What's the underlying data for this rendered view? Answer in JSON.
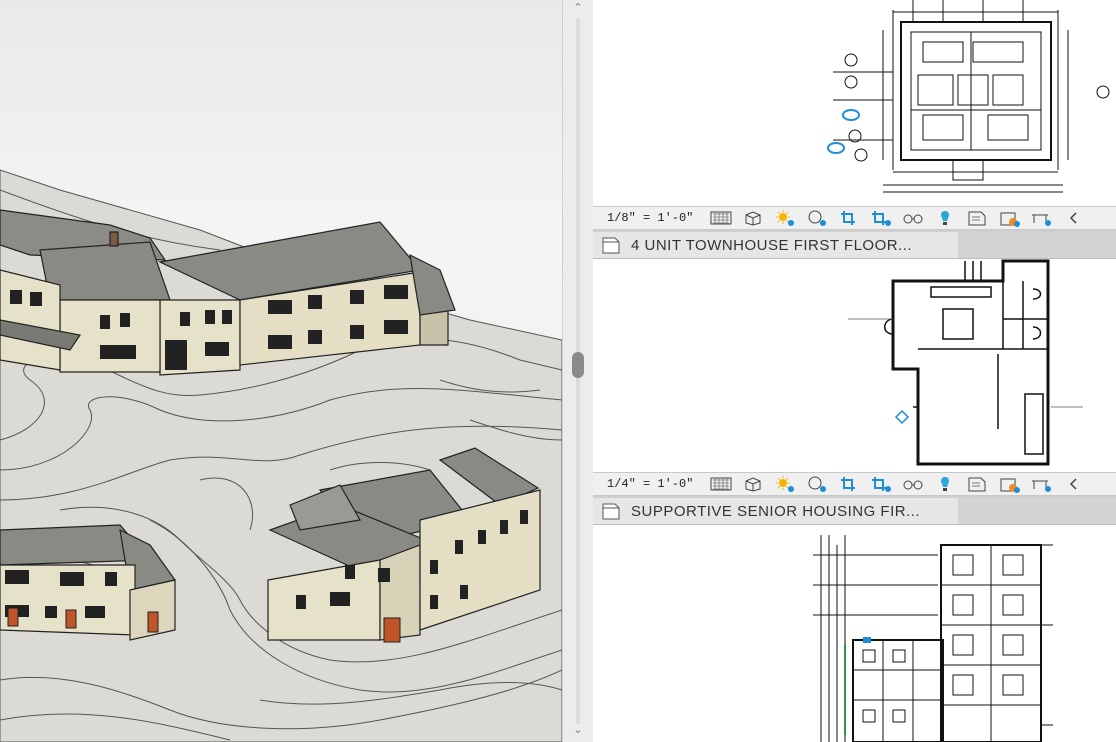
{
  "views": [
    {
      "name": "",
      "scale": "1/8\" = 1'-0\""
    },
    {
      "name": "4 UNIT TOWNHOUSE FIRST FLOOR...",
      "scale": "1/4\" = 1'-0\""
    },
    {
      "name": "SUPPORTIVE SENIOR HOUSING FIR...",
      "scale": ""
    }
  ],
  "view_control_icons": [
    "detail-level-icon",
    "visual-style-cube-icon",
    "sun-path-icon",
    "shadows-icon",
    "crop-view-icon",
    "show-crop-region-icon",
    "temporary-hide-icon",
    "reveal-hidden-icon",
    "analytical-model-icon",
    "highlight-displacement-icon",
    "worksharing-icon",
    "scroll-left-icon"
  ],
  "colors": {
    "accent_blue": "#1e8fd6",
    "sun": "#f4b400",
    "drawing": "#111111"
  }
}
